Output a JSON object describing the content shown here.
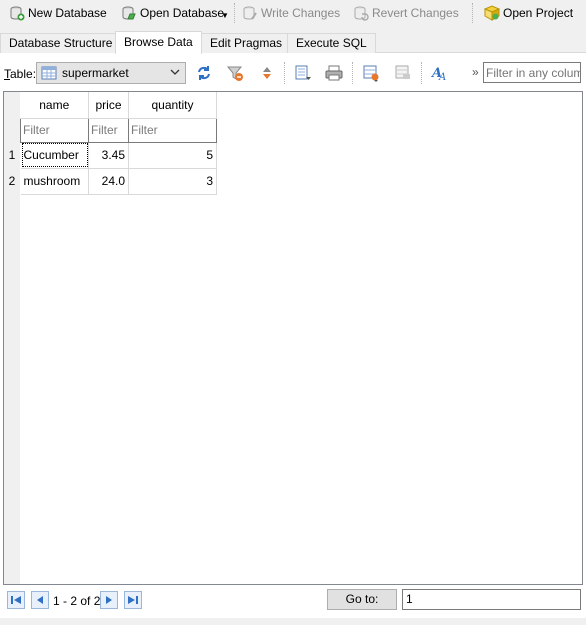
{
  "toolbar": {
    "new_database": "New Database",
    "open_database": "Open Database",
    "write_changes": "Write Changes",
    "revert_changes": "Revert Changes",
    "open_project": "Open Project"
  },
  "tabs": [
    {
      "label": "Database Structure",
      "active": false
    },
    {
      "label": "Browse Data",
      "active": true
    },
    {
      "label": "Edit Pragmas",
      "active": false
    },
    {
      "label": "Execute SQL",
      "active": false
    }
  ],
  "browse": {
    "table_label_prefix": "T",
    "table_label_rest": "able:",
    "selected_table": "supermarket",
    "filter_all_placeholder": "Filter in any column",
    "more_glyph": "»"
  },
  "grid": {
    "columns": [
      "name",
      "price",
      "quantity"
    ],
    "filter_placeholder": "Filter",
    "rows": [
      {
        "num": "1",
        "name": "Cucumber",
        "price": "3.45",
        "quantity": "5"
      },
      {
        "num": "2",
        "name": "mushroom",
        "price": "24.0",
        "quantity": "3"
      }
    ]
  },
  "navigation": {
    "range": "1 - 2 of 2",
    "goto_label": "Go to:",
    "goto_value": "1"
  },
  "colors": {
    "accent_blue": "#2f6fc4",
    "filter_orange": "#e8772e"
  }
}
